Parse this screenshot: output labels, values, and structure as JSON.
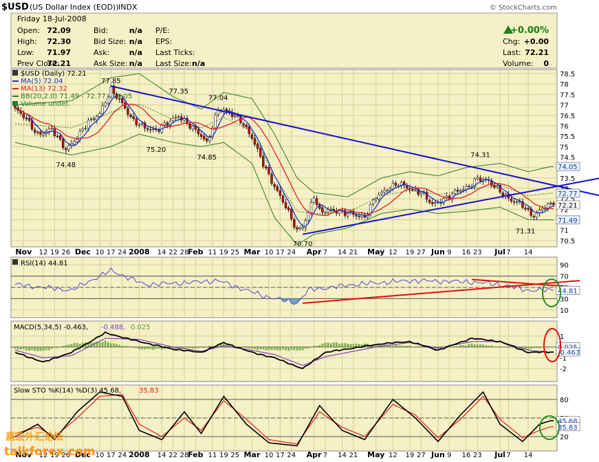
{
  "header": {
    "symbol": "$USD",
    "name": "(US Dollar Index (EOD))",
    "exchange": "INDX",
    "copyright": "© StockCharts.com",
    "date": "Friday  18-Jul-2008"
  },
  "quote": {
    "open_label": "Open:",
    "open": "72.09",
    "high_label": "High:",
    "high": "72.30",
    "low_label": "Low:",
    "low": "71.97",
    "prev_label": "Prev Close:",
    "prev": "72.21",
    "bid_label": "Bid:",
    "bid": "n/a",
    "bidsize_label": "Bid Size:",
    "bidsize": "n/a",
    "ask_label": "Ask:",
    "ask": "n/a",
    "asksize_label": "Ask Size:",
    "asksize": "n/a",
    "pe_label": "P/E:",
    "eps_label": "EPS:",
    "lastticks_label": "Last Ticks:",
    "lastsize_label": "Last Size:",
    "lastsize": "n/a",
    "pct_change": "+0.00%",
    "chg_label": "Chg:",
    "chg": "+0.00",
    "last_label": "Last:",
    "last": "72.21",
    "volume_label": "Volume:",
    "volume": "0"
  },
  "colors": {
    "panel_bg": "#f5f0c5",
    "candle": "#cc0000",
    "ma5": "#1f2fd0",
    "ma13": "#e02020",
    "bb": "#2a7a2a",
    "trendline": "#1010d0",
    "rsi_line": "#4a4ad0",
    "annot_red": "#e01010",
    "annot_green": "#209020",
    "up_arrow": "#208020",
    "pct_green": "#108010"
  },
  "legend": {
    "price": "$USD (Daily) 72.21",
    "ma5": "MA(5) 72.04",
    "ma13": "MA(13) 72.32",
    "bb": "BB(20,2.0) 71.49 - 72.77 - 74.05",
    "volume": "Volume undef."
  },
  "rsi_legend": "RSI(14) 44.81",
  "macd_legend": "MACD(5,34,5) -0.463,",
  "macd_signal_legend": "-0.488,",
  "macd_hist_legend": "0.025",
  "sto_legend": "Slow STO %K(14) %D(3) 45.68,",
  "sto_d_legend": "35.83",
  "watermark": "talkforex.com",
  "watermark_cn": "嘉宏外汇论坛",
  "chart_data": {
    "type": "candlestick",
    "price": {
      "ylim": [
        70.3,
        78.6
      ],
      "ticks": [
        70.5,
        71.0,
        71.5,
        72.0,
        72.5,
        73.0,
        73.5,
        74.0,
        74.5,
        75.0,
        75.5,
        76.0,
        76.5,
        77.0,
        77.5,
        78.0,
        78.5
      ],
      "right_tags": [
        {
          "v": 74.05,
          "label": "74.05"
        },
        {
          "v": 72.77,
          "label": "72.77"
        },
        {
          "v": 72.21,
          "label": "72.21"
        },
        {
          "v": 71.49,
          "label": "71.49"
        }
      ],
      "annotations": [
        {
          "label": "77.85",
          "v": 77.85,
          "i": 34
        },
        {
          "label": "77.35",
          "v": 77.35,
          "i": 58
        },
        {
          "label": "77.04",
          "v": 77.04,
          "i": 72
        },
        {
          "label": "74.48",
          "v": 74.48,
          "i": 18
        },
        {
          "label": "75.20",
          "v": 75.2,
          "i": 50
        },
        {
          "label": "74.85",
          "v": 74.85,
          "i": 68
        },
        {
          "label": "70.70",
          "v": 70.7,
          "i": 102
        },
        {
          "label": "74.31",
          "v": 74.31,
          "i": 165
        },
        {
          "label": "71.31",
          "v": 71.31,
          "i": 181
        }
      ],
      "trendlines": [
        {
          "from": [
            34,
            77.9
          ],
          "to": [
            196,
            73.0
          ]
        },
        {
          "from": [
            102,
            70.8
          ],
          "to": [
            196,
            73.2
          ]
        }
      ],
      "keypoints": [
        [
          0,
          76.8
        ],
        [
          4,
          76.3
        ],
        [
          8,
          75.6
        ],
        [
          13,
          75.8
        ],
        [
          18,
          74.9
        ],
        [
          22,
          75.4
        ],
        [
          26,
          76.2
        ],
        [
          30,
          76.6
        ],
        [
          34,
          77.7
        ],
        [
          38,
          77.1
        ],
        [
          42,
          76.2
        ],
        [
          46,
          75.9
        ],
        [
          50,
          75.8
        ],
        [
          54,
          76.1
        ],
        [
          58,
          76.5
        ],
        [
          62,
          76.0
        ],
        [
          66,
          75.5
        ],
        [
          68,
          75.2
        ],
        [
          72,
          76.8
        ],
        [
          76,
          76.6
        ],
        [
          80,
          76.3
        ],
        [
          84,
          75.4
        ],
        [
          88,
          74.2
        ],
        [
          92,
          73.1
        ],
        [
          96,
          72.1
        ],
        [
          100,
          71.0
        ],
        [
          102,
          71.2
        ],
        [
          104,
          71.8
        ],
        [
          106,
          72.6
        ],
        [
          108,
          71.9
        ],
        [
          112,
          72.0
        ],
        [
          116,
          71.8
        ],
        [
          120,
          71.8
        ],
        [
          124,
          71.6
        ],
        [
          128,
          72.6
        ],
        [
          132,
          73.0
        ],
        [
          136,
          73.2
        ],
        [
          140,
          73.0
        ],
        [
          144,
          72.8
        ],
        [
          148,
          72.2
        ],
        [
          152,
          72.5
        ],
        [
          156,
          72.8
        ],
        [
          160,
          73.0
        ],
        [
          164,
          73.5
        ],
        [
          168,
          73.3
        ],
        [
          172,
          72.9
        ],
        [
          176,
          72.4
        ],
        [
          180,
          72.2
        ],
        [
          182,
          71.9
        ],
        [
          184,
          71.7
        ],
        [
          188,
          72.1
        ],
        [
          190,
          72.2
        ]
      ],
      "bb_upper_keys": [
        [
          0,
          77.0
        ],
        [
          20,
          77.2
        ],
        [
          34,
          78.3
        ],
        [
          44,
          78.5
        ],
        [
          56,
          77.4
        ],
        [
          66,
          76.8
        ],
        [
          74,
          77.6
        ],
        [
          84,
          77.3
        ],
        [
          92,
          75.6
        ],
        [
          100,
          73.5
        ],
        [
          106,
          72.8
        ],
        [
          118,
          72.6
        ],
        [
          130,
          73.5
        ],
        [
          140,
          73.8
        ],
        [
          150,
          73.6
        ],
        [
          160,
          74.0
        ],
        [
          172,
          74.2
        ],
        [
          182,
          73.8
        ],
        [
          190,
          74.05
        ]
      ],
      "bb_lower_keys": [
        [
          0,
          75.2
        ],
        [
          20,
          74.6
        ],
        [
          34,
          75.0
        ],
        [
          44,
          75.6
        ],
        [
          56,
          75.2
        ],
        [
          66,
          75.0
        ],
        [
          74,
          75.2
        ],
        [
          84,
          74.2
        ],
        [
          92,
          71.6
        ],
        [
          100,
          70.3
        ],
        [
          106,
          70.8
        ],
        [
          118,
          71.1
        ],
        [
          130,
          71.8
        ],
        [
          140,
          72.0
        ],
        [
          150,
          71.8
        ],
        [
          160,
          71.9
        ],
        [
          172,
          72.1
        ],
        [
          182,
          71.5
        ],
        [
          190,
          71.49
        ]
      ]
    },
    "rsi": {
      "ylim": [
        0,
        100
      ],
      "ticks": [
        10,
        30,
        50,
        70,
        90
      ],
      "hlines": [
        30,
        70
      ],
      "right_tag": {
        "v": 44.81,
        "label": "44.81"
      },
      "keypoints": [
        [
          0,
          55
        ],
        [
          20,
          45
        ],
        [
          34,
          80
        ],
        [
          46,
          55
        ],
        [
          60,
          58
        ],
        [
          72,
          62
        ],
        [
          88,
          35
        ],
        [
          100,
          22
        ],
        [
          104,
          45
        ],
        [
          120,
          55
        ],
        [
          140,
          62
        ],
        [
          160,
          60
        ],
        [
          172,
          55
        ],
        [
          182,
          45
        ],
        [
          190,
          44.81
        ]
      ]
    },
    "macd": {
      "ylim": [
        -3,
        2.2
      ],
      "ticks": [
        -2,
        -1,
        0,
        1
      ],
      "right_tags": [
        {
          "v": 0.025,
          "label": "0.025"
        },
        {
          "v": -0.463,
          "label": "-0.463"
        }
      ],
      "macd_keys": [
        [
          0,
          -0.5
        ],
        [
          10,
          -1.4
        ],
        [
          20,
          -0.5
        ],
        [
          32,
          1.3
        ],
        [
          44,
          0.5
        ],
        [
          56,
          -0.2
        ],
        [
          66,
          -0.5
        ],
        [
          74,
          0.4
        ],
        [
          84,
          -0.5
        ],
        [
          92,
          -1.0
        ],
        [
          102,
          -2.0
        ],
        [
          110,
          -0.5
        ],
        [
          130,
          0.3
        ],
        [
          140,
          0.5
        ],
        [
          150,
          -0.3
        ],
        [
          162,
          0.8
        ],
        [
          172,
          0.5
        ],
        [
          182,
          -0.5
        ],
        [
          190,
          -0.463
        ]
      ],
      "signal_keys": [
        [
          0,
          -0.3
        ],
        [
          10,
          -1.0
        ],
        [
          20,
          -0.8
        ],
        [
          32,
          0.8
        ],
        [
          44,
          0.7
        ],
        [
          56,
          0.0
        ],
        [
          66,
          -0.4
        ],
        [
          74,
          0.1
        ],
        [
          84,
          -0.3
        ],
        [
          92,
          -0.7
        ],
        [
          102,
          -1.7
        ],
        [
          110,
          -0.9
        ],
        [
          130,
          0.1
        ],
        [
          140,
          0.4
        ],
        [
          150,
          -0.1
        ],
        [
          162,
          0.5
        ],
        [
          172,
          0.5
        ],
        [
          182,
          -0.3
        ],
        [
          190,
          -0.488
        ]
      ]
    },
    "sto": {
      "ylim": [
        0,
        100
      ],
      "ticks": [
        20,
        50,
        80
      ],
      "hlines": [
        20,
        80
      ],
      "right_tags": [
        {
          "v": 45.68,
          "label": "45.68"
        },
        {
          "v": 35.83,
          "label": "35.83"
        }
      ],
      "k_keys": [
        [
          0,
          20
        ],
        [
          8,
          40
        ],
        [
          14,
          15
        ],
        [
          22,
          60
        ],
        [
          30,
          92
        ],
        [
          38,
          85
        ],
        [
          44,
          30
        ],
        [
          52,
          15
        ],
        [
          60,
          60
        ],
        [
          66,
          25
        ],
        [
          74,
          85
        ],
        [
          82,
          40
        ],
        [
          90,
          10
        ],
        [
          100,
          5
        ],
        [
          108,
          70
        ],
        [
          116,
          30
        ],
        [
          124,
          15
        ],
        [
          134,
          80
        ],
        [
          142,
          50
        ],
        [
          150,
          12
        ],
        [
          158,
          55
        ],
        [
          166,
          92
        ],
        [
          172,
          40
        ],
        [
          180,
          12
        ],
        [
          186,
          40
        ],
        [
          190,
          45.68
        ]
      ],
      "d_keys": [
        [
          0,
          25
        ],
        [
          8,
          35
        ],
        [
          14,
          20
        ],
        [
          22,
          50
        ],
        [
          30,
          85
        ],
        [
          38,
          88
        ],
        [
          44,
          40
        ],
        [
          52,
          20
        ],
        [
          60,
          50
        ],
        [
          66,
          30
        ],
        [
          74,
          78
        ],
        [
          82,
          48
        ],
        [
          90,
          15
        ],
        [
          100,
          8
        ],
        [
          108,
          60
        ],
        [
          116,
          35
        ],
        [
          124,
          20
        ],
        [
          134,
          72
        ],
        [
          142,
          55
        ],
        [
          150,
          18
        ],
        [
          158,
          48
        ],
        [
          166,
          85
        ],
        [
          172,
          48
        ],
        [
          180,
          18
        ],
        [
          186,
          30
        ],
        [
          190,
          35.83
        ]
      ]
    },
    "x_axis": {
      "n_bars": 192,
      "labels": [
        {
          "i": 3,
          "t": "Nov",
          "m": true
        },
        {
          "i": 10,
          "t": "12"
        },
        {
          "i": 14,
          "t": "19"
        },
        {
          "i": 18,
          "t": "26"
        },
        {
          "i": 24,
          "t": "Dec",
          "m": true
        },
        {
          "i": 30,
          "t": "10"
        },
        {
          "i": 34,
          "t": "17"
        },
        {
          "i": 38,
          "t": "24"
        },
        {
          "i": 44,
          "t": "2008",
          "m": true
        },
        {
          "i": 52,
          "t": "14"
        },
        {
          "i": 56,
          "t": "22"
        },
        {
          "i": 60,
          "t": "28"
        },
        {
          "i": 64,
          "t": "Feb",
          "m": true
        },
        {
          "i": 70,
          "t": "11"
        },
        {
          "i": 74,
          "t": "19"
        },
        {
          "i": 78,
          "t": "25"
        },
        {
          "i": 84,
          "t": "Mar",
          "m": true
        },
        {
          "i": 90,
          "t": "10"
        },
        {
          "i": 94,
          "t": "17"
        },
        {
          "i": 98,
          "t": "24"
        },
        {
          "i": 106,
          "t": "Apr",
          "m": true
        },
        {
          "i": 110,
          "t": "7"
        },
        {
          "i": 116,
          "t": "14"
        },
        {
          "i": 120,
          "t": "21"
        },
        {
          "i": 128,
          "t": "May",
          "m": true
        },
        {
          "i": 134,
          "t": "12"
        },
        {
          "i": 140,
          "t": "19"
        },
        {
          "i": 144,
          "t": "27"
        },
        {
          "i": 150,
          "t": "Jun",
          "m": true
        },
        {
          "i": 154,
          "t": "9"
        },
        {
          "i": 160,
          "t": "16"
        },
        {
          "i": 164,
          "t": "23"
        },
        {
          "i": 172,
          "t": "Jul",
          "m": true
        },
        {
          "i": 175,
          "t": "7"
        },
        {
          "i": 182,
          "t": "14"
        }
      ]
    }
  }
}
